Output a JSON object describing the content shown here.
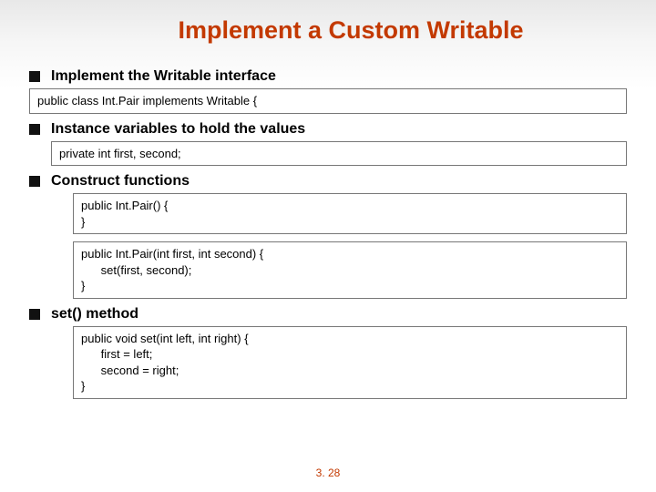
{
  "title": "Implement a Custom Writable",
  "items": [
    {
      "label": "Implement the Writable interface",
      "boxes": [
        {
          "indent": "l0",
          "code": "public class Int.Pair implements Writable {"
        }
      ]
    },
    {
      "label": "Instance variables to hold the values",
      "boxes": [
        {
          "indent": "l1",
          "code": "private int first, second;"
        }
      ]
    },
    {
      "label": "Construct functions",
      "boxes": [
        {
          "indent": "l2",
          "code": "public Int.Pair() {\n}"
        },
        {
          "indent": "l2",
          "code": "public Int.Pair(int first, int second) {\n      set(first, second);\n}"
        }
      ]
    },
    {
      "label": "set() method",
      "boxes": [
        {
          "indent": "l2",
          "code": "public void set(int left, int right) {\n      first = left;\n      second = right;\n}"
        }
      ]
    }
  ],
  "footer": "3. 28"
}
